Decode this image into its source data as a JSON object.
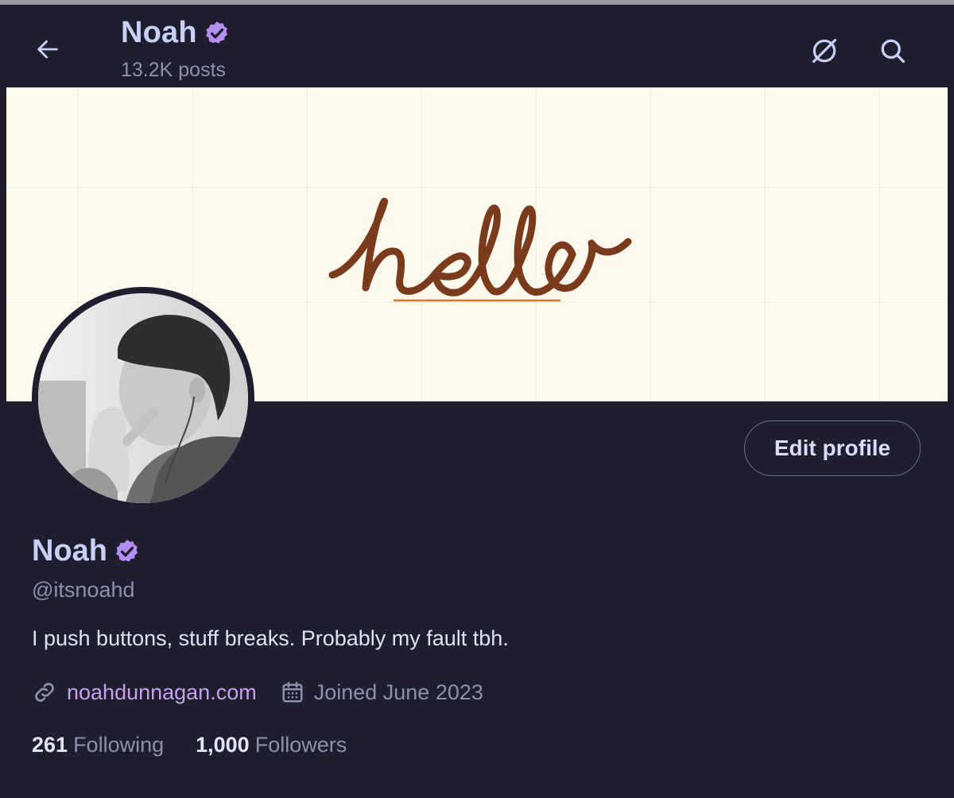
{
  "header": {
    "title": "Noah",
    "posts_count": "13.2K posts",
    "back_icon": "arrow-left-icon",
    "grok_icon": "slashed-circle-icon",
    "search_icon": "search-icon"
  },
  "banner": {
    "text": "hello"
  },
  "profile": {
    "name": "Noah",
    "handle": "@itsnoahd",
    "bio": "I push buttons, stuff breaks. Probably my fault tbh.",
    "website": "noahdunnagan.com",
    "joined": "Joined June 2023",
    "edit_label": "Edit profile",
    "following_count": "261",
    "following_label": "Following",
    "followers_count": "1,000",
    "followers_label": "Followers"
  },
  "colors": {
    "background": "#1e1e2e",
    "accent": "#c7a0f0",
    "verified": "#b48ef0",
    "banner": "#fefaee",
    "hello": "#7a3a1c"
  }
}
